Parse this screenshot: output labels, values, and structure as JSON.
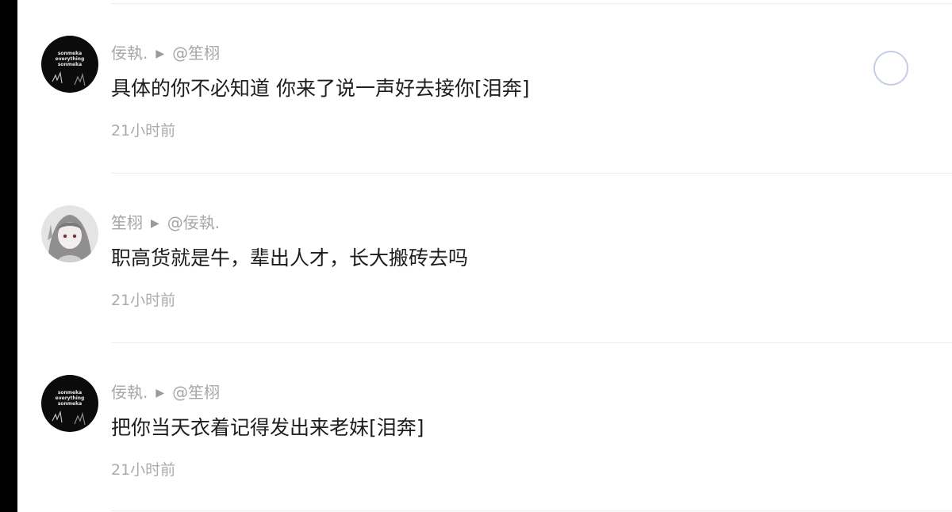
{
  "comments": [
    {
      "author": "佞執.",
      "reply_to": "@笙栩",
      "text": "具体的你不必知道 你来了说一声好去接你[泪奔]",
      "time": "21小时前",
      "avatar_lines": [
        "sonmeka",
        "everything",
        "sonmeka"
      ]
    },
    {
      "author": "笙栩",
      "reply_to": "@佞執.",
      "text": "职高货就是牛，辈出人才，长大搬砖去吗",
      "time": "21小时前"
    },
    {
      "author": "佞執.",
      "reply_to": "@笙栩",
      "text": "把你当天衣着记得发出来老妹[泪奔]",
      "time": "21小时前",
      "avatar_lines": [
        "sonmeka",
        "everything",
        "sonmeka"
      ]
    }
  ],
  "reply_arrow": "▶",
  "icons": {
    "select": "circle-select-icon"
  },
  "colors": {
    "text": "#1d1d1d",
    "meta": "#a6a6a6",
    "divider": "#ececec",
    "circle_border": "#c6cde6"
  }
}
